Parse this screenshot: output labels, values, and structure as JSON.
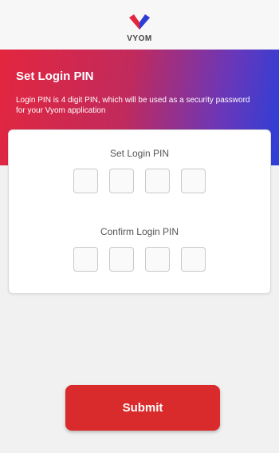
{
  "brand": {
    "name": "VYOM",
    "logo_icon": "checkmark-heart-icon",
    "accent": "#e3263f"
  },
  "header": {
    "title": "Set Login PIN",
    "description": "Login PIN is 4 digit PIN, which will be used as a security password for your Vyom application"
  },
  "form": {
    "set_label": "Set Login PIN",
    "confirm_label": "Confirm Login PIN",
    "set_pin": [
      "",
      "",
      "",
      ""
    ],
    "confirm_pin": [
      "",
      "",
      "",
      ""
    ]
  },
  "submit_label": "Submit",
  "colors": {
    "gradient_start": "#e3263f",
    "gradient_end": "#2b3fd8",
    "button": "#d92b2b"
  }
}
